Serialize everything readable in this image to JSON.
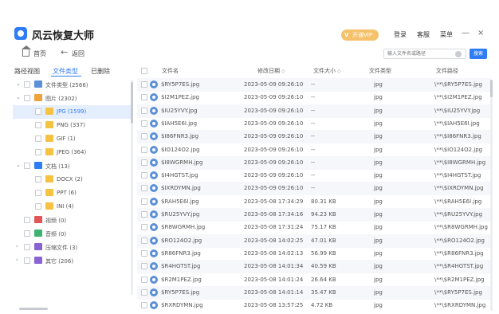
{
  "app": {
    "title": "风云恢复大师",
    "vip_label": "开通VIP",
    "links": [
      "登录",
      "客服",
      "菜单"
    ],
    "minimize": "—",
    "close": "×"
  },
  "toolbar": {
    "home_label": "首页",
    "back_label": "返回",
    "search_placeholder": "输入文件名或路径",
    "search_button": "搜索"
  },
  "left_tabs": [
    "路径视图",
    "文件类型",
    "已删除"
  ],
  "tree": [
    {
      "label": "文件类型 (2566)",
      "expanded": true,
      "icon": "drive-icon",
      "color": "#5b8fd8"
    },
    {
      "label": "图片 (2302)",
      "expanded": true,
      "icon": "image-folder-icon",
      "color": "#f0a23a"
    },
    {
      "label": "JPG (1599)",
      "selected": true,
      "icon": "folder-icon",
      "color": "#f5c242"
    },
    {
      "label": "PNG (337)",
      "icon": "folder-icon",
      "color": "#f5c242"
    },
    {
      "label": "GIF (1)",
      "icon": "folder-icon",
      "color": "#f5c242"
    },
    {
      "label": "JPEG (364)",
      "icon": "folder-icon",
      "color": "#f5c242"
    },
    {
      "label": "文档 (13)",
      "expanded": true,
      "icon": "document-folder-icon",
      "color": "#2f7df6"
    },
    {
      "label": "DOCX (2)",
      "icon": "folder-icon",
      "color": "#f5c242"
    },
    {
      "label": "PPT (6)",
      "icon": "folder-icon",
      "color": "#f5c242"
    },
    {
      "label": "INI (4)",
      "icon": "folder-icon",
      "color": "#f5c242"
    },
    {
      "label": "视频 (0)",
      "icon": "video-folder-icon",
      "color": "#e05555"
    },
    {
      "label": "音频 (0)",
      "icon": "audio-folder-icon",
      "color": "#3cb371"
    },
    {
      "label": "压缩文件 (3)",
      "collapsed": true,
      "icon": "archive-folder-icon",
      "color": "#8a63d2"
    },
    {
      "label": "其它 (206)",
      "collapsed": true,
      "icon": "other-folder-icon",
      "color": "#8a63d2"
    }
  ],
  "table": {
    "headers": [
      "文件名",
      "修改日期",
      "文件大小",
      "文件类型",
      "文件路径"
    ],
    "sort_icon": "◇",
    "rows": [
      [
        "$RY5P7ES.jpg",
        "2023-05-09 09:26:10",
        "--",
        "jpg",
        "\\**\\$RY5P7ES.jpg"
      ],
      [
        "$I2M1PEZ.jpg",
        "2023-05-09 09:26:10",
        "--",
        "jpg",
        "\\**\\$I2M1PEZ.jpg"
      ],
      [
        "$IU25YVY.jpg",
        "2023-05-09 09:26:10",
        "--",
        "jpg",
        "\\**\\$IU25YVY.jpg"
      ],
      [
        "$IAH5E6I.jpg",
        "2023-05-09 09:26:10",
        "--",
        "jpg",
        "\\**\\$IAH5E6I.jpg"
      ],
      [
        "$I86FNR3.jpg",
        "2023-05-09 09:26:10",
        "--",
        "jpg",
        "\\**\\$I86FNR3.jpg"
      ],
      [
        "$IO124O2.jpg",
        "2023-05-09 09:26:10",
        "--",
        "jpg",
        "\\**\\$IO124O2.jpg"
      ],
      [
        "$I8WGRMH.jpg",
        "2023-05-09 09:26:10",
        "--",
        "jpg",
        "\\**\\$I8WGRMH.jpg"
      ],
      [
        "$I4HGTST.jpg",
        "2023-05-09 09:26:10",
        "--",
        "jpg",
        "\\**\\$I4HGTST.jpg"
      ],
      [
        "$IXRDYMN.jpg",
        "2023-05-09 09:26:10",
        "--",
        "jpg",
        "\\**\\$IXRDYMN.jpg"
      ],
      [
        "$RAH5E6I.jpg",
        "2023-05-08 17:34:29",
        "80.31 KB",
        "jpg",
        "\\**\\$RAH5E6I.jpg"
      ],
      [
        "$RU25YVY.jpg",
        "2023-05-08 17:34:16",
        "94.23 KB",
        "jpg",
        "\\**\\$RU25YVY.jpg"
      ],
      [
        "$R8WGRMH.jpg",
        "2023-05-08 17:31:24",
        "75.17 KB",
        "jpg",
        "\\**\\$R8WGRMH.jpg"
      ],
      [
        "$RO124O2.jpg",
        "2023-05-08 14:02:25",
        "47.01 KB",
        "jpg",
        "\\**\\$RO124O2.jpg"
      ],
      [
        "$R86FNR3.jpg",
        "2023-05-08 14:02:13",
        "56.99 KB",
        "jpg",
        "\\**\\$R86FNR3.jpg"
      ],
      [
        "$R4HGTST.jpg",
        "2023-05-08 14:01:34",
        "40.59 KB",
        "jpg",
        "\\**\\$R4HGTST.jpg"
      ],
      [
        "$R2M1PEZ.jpg",
        "2023-05-08 14:01:24",
        "26.64 KB",
        "jpg",
        "\\**\\$R2M1PEZ.jpg"
      ],
      [
        "$RY5P7ES.jpg",
        "2023-05-08 14:01:14",
        "35.47 KB",
        "jpg",
        "\\**\\$RY5P7ES.jpg"
      ],
      [
        "$RXRDYMN.jpg",
        "2023-05-08 13:57:25",
        "4.72 KB",
        "jpg",
        "\\**\\$RXRDYMN.jpg"
      ]
    ]
  }
}
